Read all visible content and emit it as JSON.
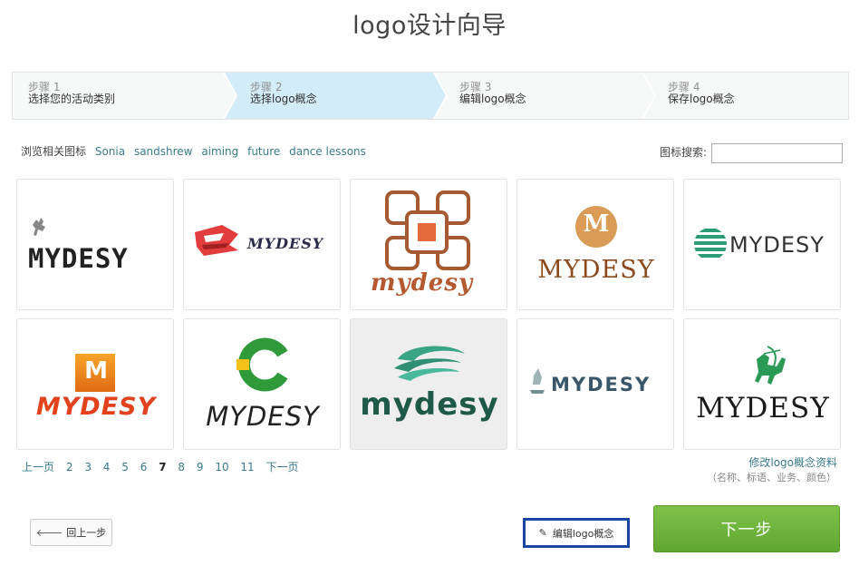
{
  "title": "logo设计向导",
  "steps": [
    {
      "num": "步骤 1",
      "name": "选择您的活动类别"
    },
    {
      "num": "步骤 2",
      "name": "选择logo概念"
    },
    {
      "num": "步骤 3",
      "name": "编辑logo概念"
    },
    {
      "num": "步骤 4",
      "name": "保存logo概念"
    }
  ],
  "related": {
    "label": "浏览相关图标",
    "tags": [
      "Sonia",
      "sandshrew",
      "aiming",
      "future",
      "dance lessons"
    ]
  },
  "search": {
    "label": "图标搜索:",
    "value": ""
  },
  "logos": [
    {
      "text": "MYDESY"
    },
    {
      "text": "MYDESY"
    },
    {
      "text": "mydesy"
    },
    {
      "text": "MYDESY",
      "badge": "M"
    },
    {
      "text": "MYDESY"
    },
    {
      "text": "MYDESY",
      "badge": "M"
    },
    {
      "text": "MYDESY"
    },
    {
      "text": "mydesy"
    },
    {
      "text": "MYDESY"
    },
    {
      "text": "MYDESY"
    }
  ],
  "pager": {
    "prev": "上一页",
    "pages": [
      "2",
      "3",
      "4",
      "5",
      "6",
      "7",
      "8",
      "9",
      "10",
      "11"
    ],
    "current": "7",
    "next": "下一页"
  },
  "modify": {
    "link": "修改logo概念资料",
    "note": "（名称、标语、业务、颜色）"
  },
  "buttons": {
    "back": "回上一步",
    "edit": "编辑logo概念",
    "next": "下一步"
  }
}
